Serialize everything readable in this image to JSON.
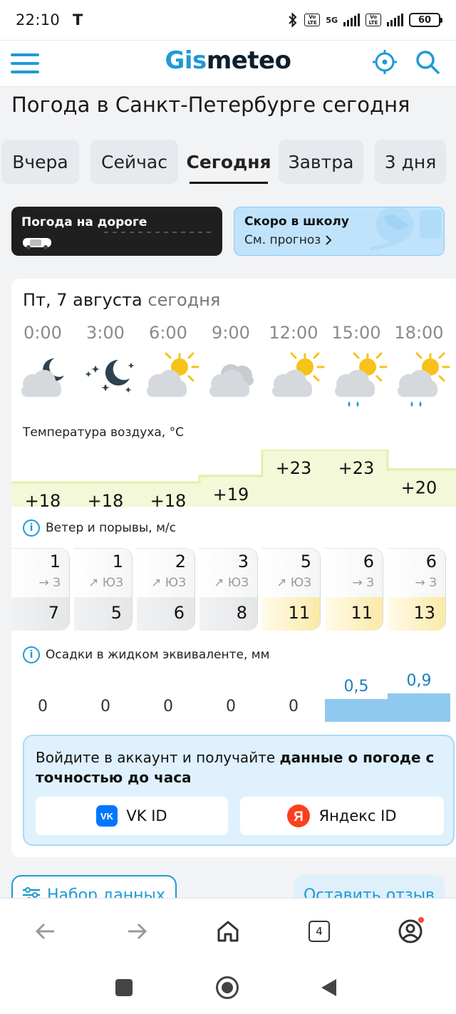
{
  "status_bar": {
    "time": "22:10",
    "carrier": "T",
    "network_1": "5G",
    "volte": "Vo LTE",
    "battery": "60"
  },
  "header": {
    "logo_part1": "Gis",
    "logo_part2": "meteo",
    "menu_icon": "menu-icon",
    "locate_icon": "location-target-icon",
    "search_icon": "search-icon",
    "accent_color": "#1e9ad6"
  },
  "page_title": "Погода в Санкт-Петербурге сегодня",
  "tabs": [
    {
      "label": "Вчера"
    },
    {
      "label": "Сейчас"
    },
    {
      "label": "Сегодня",
      "active": true
    },
    {
      "label": "Завтра"
    },
    {
      "label": "3 дня"
    }
  ],
  "banners": {
    "road_title": "Погода на дороге",
    "school_title": "Скоро в школу",
    "school_link": "См. прогноз"
  },
  "forecast": {
    "date": "Пт, 7 августа",
    "today_label": "сегодня",
    "times": [
      "0:00",
      "3:00",
      "6:00",
      "9:00",
      "12:00",
      "15:00",
      "18:00"
    ],
    "conditions": [
      "cloud-moon-icon",
      "night-stars-moon-icon",
      "sun-cloud-icon",
      "cloudy-icon",
      "sun-cloud-icon",
      "sun-cloud-rain-icon",
      "sun-cloud-rain-icon"
    ],
    "temperature_label": "Температура воздуха, °C",
    "temperatures": [
      "+18",
      "+18",
      "+18",
      "+19",
      "+23",
      "+23",
      "+20"
    ],
    "temperature_values": [
      18,
      18,
      18,
      19,
      23,
      23,
      20
    ],
    "wind_label": "Ветер и порывы, м/с",
    "wind": [
      {
        "speed": "1",
        "dir": "→ З",
        "gust": "7"
      },
      {
        "speed": "1",
        "dir": "↗ ЮЗ",
        "gust": "5"
      },
      {
        "speed": "2",
        "dir": "↗ ЮЗ",
        "gust": "6"
      },
      {
        "speed": "3",
        "dir": "↗ ЮЗ",
        "gust": "8"
      },
      {
        "speed": "5",
        "dir": "↗ ЮЗ",
        "gust": "11"
      },
      {
        "speed": "6",
        "dir": "→ З",
        "gust": "11"
      },
      {
        "speed": "6",
        "dir": "→ З",
        "gust": "13"
      }
    ],
    "precip_label": "Осадки в жидком эквиваленте, мм",
    "precipitation": [
      "0",
      "0",
      "0",
      "0",
      "0",
      "0,5",
      "0,9"
    ],
    "precipitation_values": [
      0,
      0,
      0,
      0,
      0,
      0.5,
      0.9
    ]
  },
  "login": {
    "text_plain": "Войдите в аккаунт и получайте ",
    "text_bold": "данные о погоде с точностью до часа",
    "vk_label": "VK ID",
    "yandex_label": "Яндекс ID"
  },
  "bottom": {
    "data_set_button": "Набор данных",
    "feedback_button": "Оставить отзыв"
  },
  "browser": {
    "tab_count": "4"
  }
}
